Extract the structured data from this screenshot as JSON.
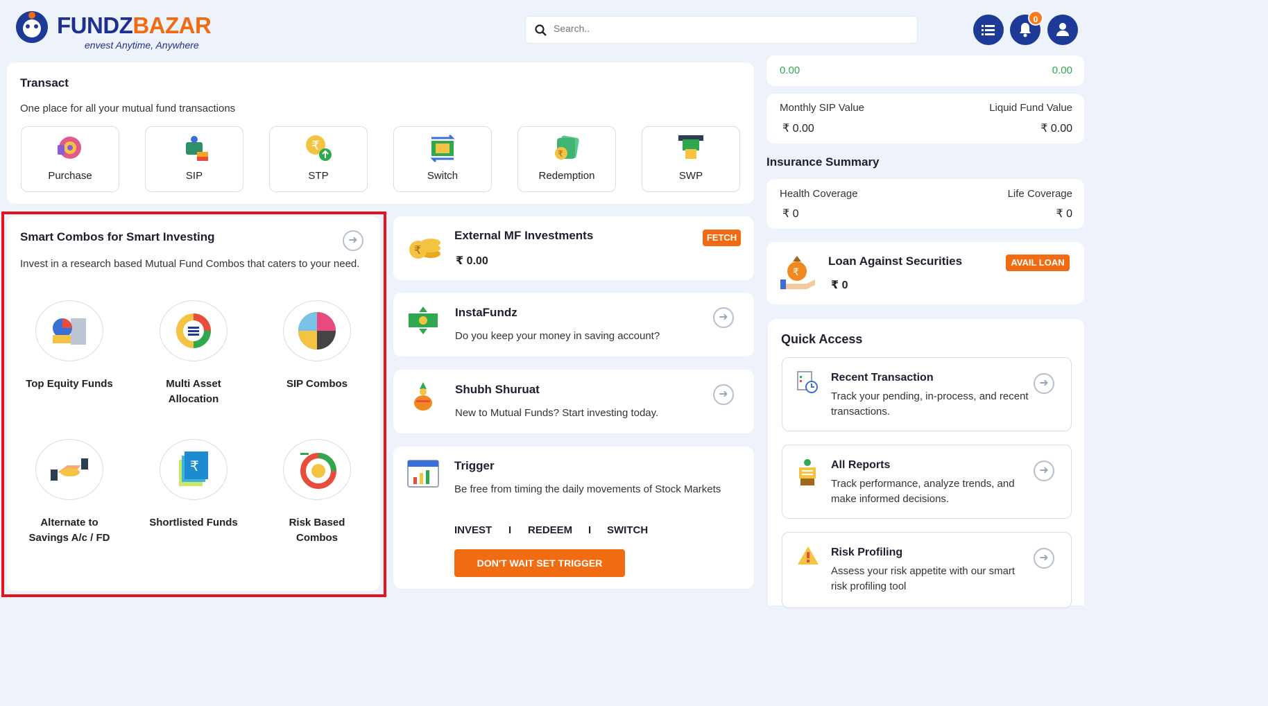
{
  "header": {
    "logo_part1": "FUNDZ",
    "logo_part2": "BAZAR",
    "tagline": "envest Anytime, Anywhere",
    "search_placeholder": "Search..",
    "notification_count": "0"
  },
  "transact": {
    "title": "Transact",
    "subtitle": "One place for all your mutual fund transactions",
    "items": [
      {
        "label": "Purchase",
        "icon": "purchase-icon"
      },
      {
        "label": "SIP",
        "icon": "sip-icon"
      },
      {
        "label": "STP",
        "icon": "stp-icon"
      },
      {
        "label": "Switch",
        "icon": "switch-icon"
      },
      {
        "label": "Redemption",
        "icon": "redemption-icon"
      },
      {
        "label": "SWP",
        "icon": "swp-icon"
      }
    ]
  },
  "combos": {
    "title": "Smart Combos for Smart Investing",
    "subtitle": "Invest in a research based Mutual Fund Combos that caters to your need.",
    "items": [
      {
        "label": "Top Equity Funds"
      },
      {
        "label": "Multi Asset Allocation"
      },
      {
        "label": "SIP Combos"
      },
      {
        "label": "Alternate to Savings A/c / FD"
      },
      {
        "label": "Shortlisted Funds"
      },
      {
        "label": "Risk Based Combos"
      }
    ]
  },
  "external_mf": {
    "title": "External MF Investments",
    "value": "₹ 0.00",
    "button": "FETCH"
  },
  "instafundz": {
    "title": "InstaFundz",
    "subtitle": "Do you keep your money in saving account?"
  },
  "shubh": {
    "title": "Shubh Shuruat",
    "subtitle": "New to Mutual Funds? Start investing today."
  },
  "trigger": {
    "title": "Trigger",
    "subtitle": "Be free from timing the daily movements of Stock Markets",
    "options": [
      "INVEST",
      "REDEEM",
      "SWITCH"
    ],
    "separator": "I",
    "button": "DON'T WAIT SET TRIGGER"
  },
  "portfolio": {
    "top_left_value": "0.00",
    "top_right_value": "0.00",
    "monthly_sip_label": "Monthly SIP Value",
    "monthly_sip_value": "₹ 0.00",
    "liquid_fund_label": "Liquid Fund Value",
    "liquid_fund_value": "₹ 0.00"
  },
  "insurance": {
    "title": "Insurance Summary",
    "health_label": "Health Coverage",
    "health_value": "₹ 0",
    "life_label": "Life Coverage",
    "life_value": "₹ 0"
  },
  "loan": {
    "title": "Loan Against Securities",
    "value": "₹ 0",
    "button": "AVAIL LOAN"
  },
  "quick_access": {
    "title": "Quick Access",
    "items": [
      {
        "title": "Recent Transaction",
        "desc": "Track your pending, in-process, and recent transactions."
      },
      {
        "title": "All Reports",
        "desc": "Track performance, analyze trends, and make informed decisions."
      },
      {
        "title": "Risk Profiling",
        "desc": "Assess your risk appetite with our smart risk profiling tool"
      }
    ]
  },
  "colors": {
    "brand_blue": "#1d2f8f",
    "brand_orange": "#f06b12",
    "highlight_red": "#e8141b",
    "positive_green": "#2fa84f"
  }
}
